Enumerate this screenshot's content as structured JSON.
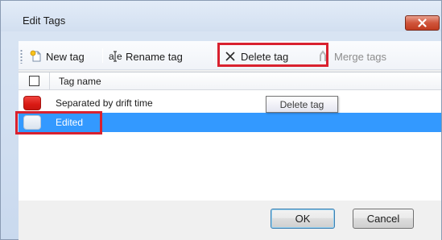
{
  "window": {
    "title": "Edit Tags"
  },
  "toolbar": {
    "new_tag": "New tag",
    "rename_tag": "Rename tag",
    "delete_tag": "Delete tag",
    "merge_tags": "Merge tags"
  },
  "list": {
    "column_header": "Tag name",
    "rows": [
      {
        "label": "Separated by drift time",
        "color": "#e0201b",
        "selected": false
      },
      {
        "label": "Edited",
        "color": "#e8eef6",
        "selected": true
      }
    ]
  },
  "tooltip": {
    "text": "Delete tag"
  },
  "buttons": {
    "ok": "OK",
    "cancel": "Cancel"
  },
  "colors": {
    "selection": "#3399ff",
    "annotation_highlight": "#d9212f"
  },
  "icons": {
    "new_tag": "new-tag-icon",
    "rename_tag": "rename-icon",
    "delete_tag": "delete-x-icon",
    "merge_tags": "merge-icon",
    "close": "close-icon"
  }
}
